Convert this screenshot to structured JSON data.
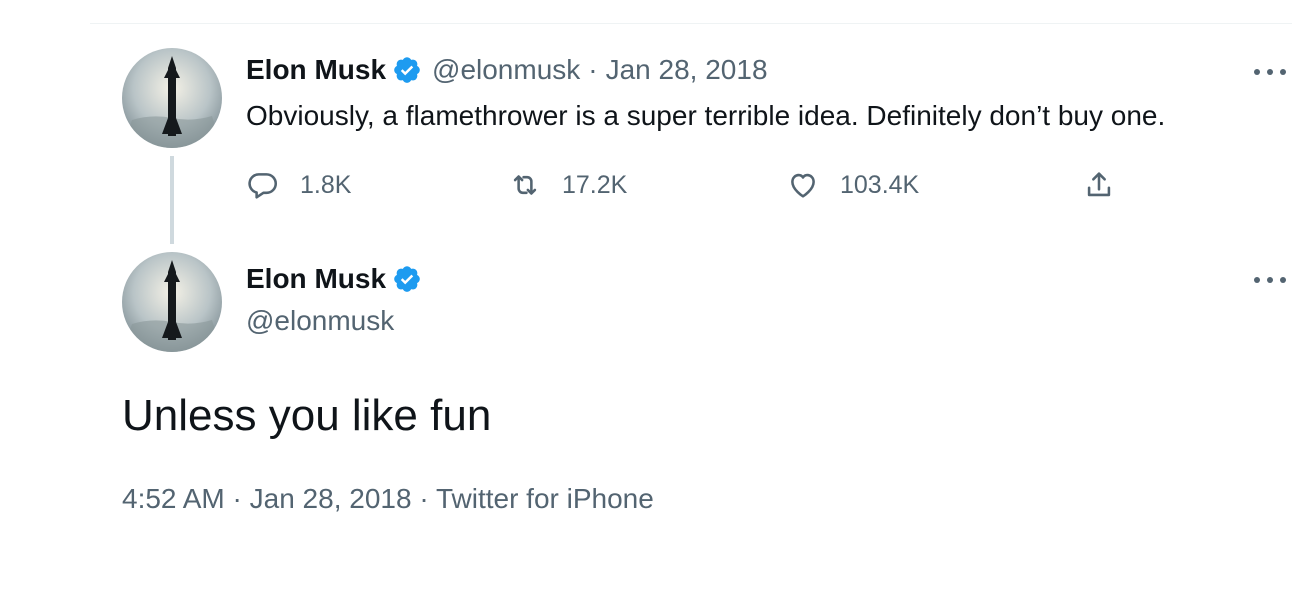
{
  "tweet1": {
    "name": "Elon Musk",
    "handle": "@elonmusk",
    "separator": "·",
    "date": "Jan 28, 2018",
    "text": "Obviously, a flamethrower is a super terrible idea. Definitely don’t buy one.",
    "replies": "1.8K",
    "retweets": "17.2K",
    "likes": "103.4K"
  },
  "tweet2": {
    "name": "Elon Musk",
    "handle": "@elonmusk",
    "text": "Unless you like fun",
    "time": "4:52 AM",
    "separator": "·",
    "date": "Jan 28, 2018",
    "source": "Twitter for iPhone"
  },
  "icons": {
    "verified": "verified-badge-icon",
    "more": "more-icon",
    "reply": "reply-icon",
    "retweet": "retweet-icon",
    "like": "like-icon",
    "share": "share-icon"
  },
  "colors": {
    "verified_blue": "#1d9bf0",
    "secondary_text": "#536471",
    "primary_text": "#0f1419",
    "thread_line": "#cfd9de"
  }
}
